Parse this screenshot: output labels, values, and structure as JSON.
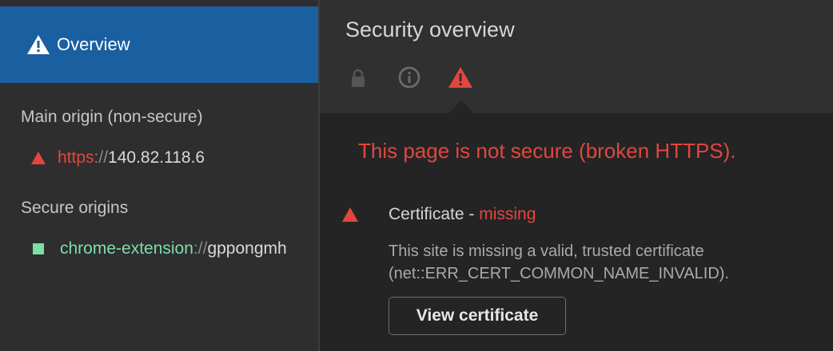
{
  "sidebar": {
    "overview_label": "Overview",
    "main_origin_title": "Main origin (non-secure)",
    "main_origin": {
      "scheme": "https",
      "separator": "://",
      "host": "140.82.118.6"
    },
    "secure_origins_title": "Secure origins",
    "secure_origins": [
      {
        "scheme": "chrome-extension",
        "separator": "://",
        "host": "gppongmh"
      }
    ]
  },
  "main": {
    "title": "Security overview",
    "state_icons": [
      "lock-icon",
      "info-icon",
      "warning-icon"
    ],
    "summary": "This page is not secure (broken HTTPS).",
    "certificate": {
      "name": "Certificate",
      "dash": "-",
      "status": "missing",
      "desc_line1": "This site is missing a valid, trusted certificate",
      "desc_line2": "(net::ERR_CERT_COMMON_NAME_INVALID).",
      "button_label": "View certificate"
    }
  },
  "colors": {
    "accent_blue": "#1a5fa0",
    "danger_red": "#e2463e",
    "secure_green": "#7cdfa6"
  }
}
